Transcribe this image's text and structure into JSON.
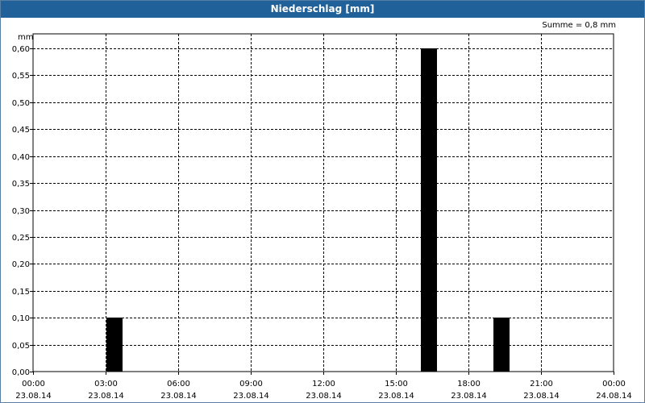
{
  "window": {
    "title": "Niederschlag [mm]"
  },
  "summary": {
    "label": "Summe = 0,8 mm"
  },
  "chart_data": {
    "type": "bar",
    "title": "Niederschlag [mm]",
    "ylabel": "mm",
    "xlabel": "",
    "ylim": [
      0,
      0.62
    ],
    "y_ticks": [
      "0,00",
      "0,05",
      "0,10",
      "0,15",
      "0,20",
      "0,25",
      "0,30",
      "0,35",
      "0,40",
      "0,45",
      "0,50",
      "0,55",
      "0,60"
    ],
    "y_tick_values": [
      0,
      0.05,
      0.1,
      0.15,
      0.2,
      0.25,
      0.3,
      0.35,
      0.4,
      0.45,
      0.5,
      0.55,
      0.6
    ],
    "x_range": [
      "2014-08-23 00:00",
      "2014-08-24 00:00"
    ],
    "x_ticks": [
      {
        "time": "00:00",
        "date": "23.08.14"
      },
      {
        "time": "03:00",
        "date": "23.08.14"
      },
      {
        "time": "06:00",
        "date": "23.08.14"
      },
      {
        "time": "09:00",
        "date": "23.08.14"
      },
      {
        "time": "12:00",
        "date": "23.08.14"
      },
      {
        "time": "15:00",
        "date": "23.08.14"
      },
      {
        "time": "18:00",
        "date": "23.08.14"
      },
      {
        "time": "21:00",
        "date": "23.08.14"
      },
      {
        "time": "00:00",
        "date": "24.08.14"
      }
    ],
    "bars": [
      {
        "start": "03:00",
        "end": "03:40",
        "value": 0.1
      },
      {
        "start": "16:00",
        "end": "16:40",
        "value": 0.6
      },
      {
        "start": "19:00",
        "end": "19:40",
        "value": 0.1
      }
    ],
    "grid": true,
    "bar_color": "#000000",
    "summary": "Summe = 0,8 mm"
  }
}
